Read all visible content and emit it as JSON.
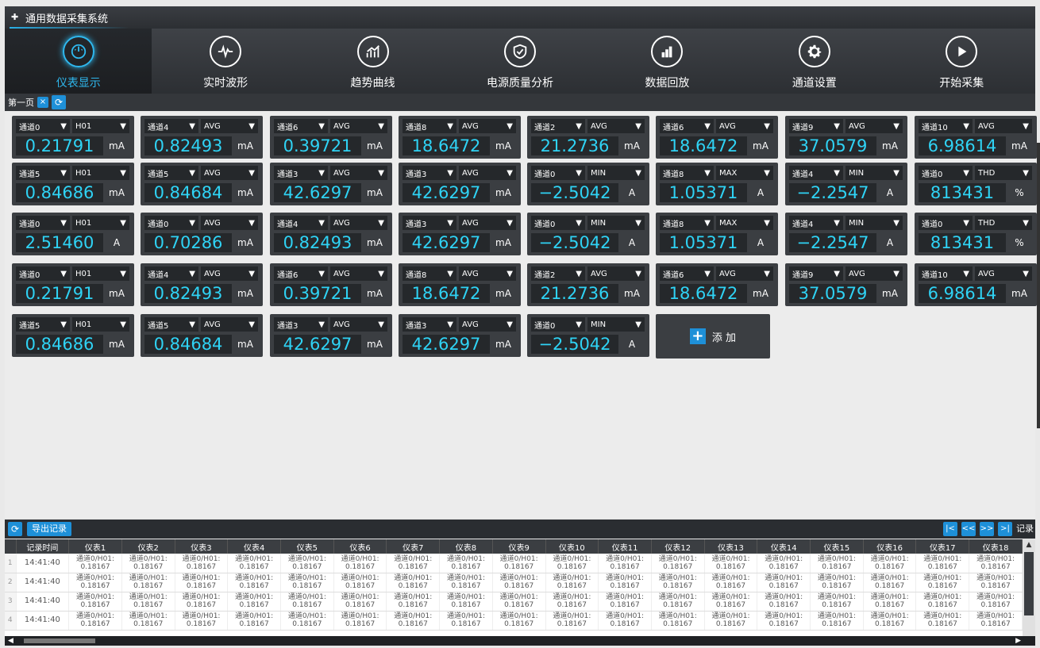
{
  "app": {
    "title": "通用数据采集系统"
  },
  "nav": [
    {
      "label": "仪表显示",
      "icon": "gauge-icon",
      "active": true
    },
    {
      "label": "实时波形",
      "icon": "pulse-icon"
    },
    {
      "label": "趋势曲线",
      "icon": "trend-chart-icon"
    },
    {
      "label": "电源质量分析",
      "icon": "shield-check-icon"
    },
    {
      "label": "数据回放",
      "icon": "bar-chart-icon"
    },
    {
      "label": "通道设置",
      "icon": "gear-icon"
    },
    {
      "label": "开始采集",
      "icon": "play-icon"
    }
  ],
  "page_tab": {
    "label": "第一页",
    "close": "×",
    "refresh": "⟳"
  },
  "meters": [
    {
      "ch": "通道0",
      "type": "H01",
      "value": "0.21791",
      "unit": "mA"
    },
    {
      "ch": "通道4",
      "type": "AVG",
      "value": "0.82493",
      "unit": "mA"
    },
    {
      "ch": "通道6",
      "type": "AVG",
      "value": "0.39721",
      "unit": "mA"
    },
    {
      "ch": "通道8",
      "type": "AVG",
      "value": "18.6472",
      "unit": "mA"
    },
    {
      "ch": "通道2",
      "type": "AVG",
      "value": "21.2736",
      "unit": "mA"
    },
    {
      "ch": "通道6",
      "type": "AVG",
      "value": "18.6472",
      "unit": "mA"
    },
    {
      "ch": "通道9",
      "type": "AVG",
      "value": "37.0579",
      "unit": "mA"
    },
    {
      "ch": "通道10",
      "type": "AVG",
      "value": "6.98614",
      "unit": "mA"
    },
    {
      "ch": "通道5",
      "type": "H01",
      "value": "0.84686",
      "unit": "mA"
    },
    {
      "ch": "通道5",
      "type": "AVG",
      "value": "0.84684",
      "unit": "mA"
    },
    {
      "ch": "通道3",
      "type": "AVG",
      "value": "42.6297",
      "unit": "mA"
    },
    {
      "ch": "通道3",
      "type": "AVG",
      "value": "42.6297",
      "unit": "mA"
    },
    {
      "ch": "通道0",
      "type": "MIN",
      "value": "−2.5042",
      "unit": "A"
    },
    {
      "ch": "通道8",
      "type": "MAX",
      "value": "1.05371",
      "unit": "A"
    },
    {
      "ch": "通道4",
      "type": "MIN",
      "value": "−2.2547",
      "unit": "A"
    },
    {
      "ch": "通道0",
      "type": "THD",
      "value": "813431",
      "unit": "%"
    },
    {
      "ch": "通道0",
      "type": "H01",
      "value": "2.51460",
      "unit": "A"
    },
    {
      "ch": "通道0",
      "type": "AVG",
      "value": "0.70286",
      "unit": "mA"
    },
    {
      "ch": "通道4",
      "type": "AVG",
      "value": "0.82493",
      "unit": "mA"
    },
    {
      "ch": "通道3",
      "type": "AVG",
      "value": "42.6297",
      "unit": "mA"
    },
    {
      "ch": "通道0",
      "type": "MIN",
      "value": "−2.5042",
      "unit": "A"
    },
    {
      "ch": "通道8",
      "type": "MAX",
      "value": "1.05371",
      "unit": "A"
    },
    {
      "ch": "通道4",
      "type": "MIN",
      "value": "−2.2547",
      "unit": "A"
    },
    {
      "ch": "通道0",
      "type": "THD",
      "value": "813431",
      "unit": "%"
    },
    {
      "ch": "通道0",
      "type": "H01",
      "value": "0.21791",
      "unit": "mA"
    },
    {
      "ch": "通道4",
      "type": "AVG",
      "value": "0.82493",
      "unit": "mA"
    },
    {
      "ch": "通道6",
      "type": "AVG",
      "value": "0.39721",
      "unit": "mA"
    },
    {
      "ch": "通道8",
      "type": "AVG",
      "value": "18.6472",
      "unit": "mA"
    },
    {
      "ch": "通道2",
      "type": "AVG",
      "value": "21.2736",
      "unit": "mA"
    },
    {
      "ch": "通道6",
      "type": "AVG",
      "value": "18.6472",
      "unit": "mA"
    },
    {
      "ch": "通道9",
      "type": "AVG",
      "value": "37.0579",
      "unit": "mA"
    },
    {
      "ch": "通道10",
      "type": "AVG",
      "value": "6.98614",
      "unit": "mA"
    },
    {
      "ch": "通道5",
      "type": "H01",
      "value": "0.84686",
      "unit": "mA"
    },
    {
      "ch": "通道5",
      "type": "AVG",
      "value": "0.84684",
      "unit": "mA"
    },
    {
      "ch": "通道3",
      "type": "AVG",
      "value": "42.6297",
      "unit": "mA"
    },
    {
      "ch": "通道3",
      "type": "AVG",
      "value": "42.6297",
      "unit": "mA"
    },
    {
      "ch": "通道0",
      "type": "MIN",
      "value": "−2.5042",
      "unit": "A"
    }
  ],
  "dropdown_arrow": "▼",
  "add_button": {
    "label": "添 加",
    "icon": "plus-icon"
  },
  "records_toolbar": {
    "refresh": "⟳",
    "export_label": "导出记录",
    "pager": {
      "first": "|<",
      "prev": "<<",
      "next": ">>",
      "last": ">|",
      "label": "记录"
    }
  },
  "table": {
    "headers": [
      "记录时间",
      "仪表1",
      "仪表2",
      "仪表3",
      "仪表4",
      "仪表5",
      "仪表6",
      "仪表7",
      "仪表8",
      "仪表9",
      "仪表10",
      "仪表11",
      "仪表12",
      "仪表13",
      "仪表14",
      "仪表15",
      "仪表16",
      "仪表17",
      "仪表18"
    ],
    "rows": [
      {
        "index": "1",
        "time": "14:41:40",
        "cell_line1": "通道0/H01:",
        "cell_line2": "0.18167"
      },
      {
        "index": "2",
        "time": "14:41:40",
        "cell_line1": "通道0/H01:",
        "cell_line2": "0.18167"
      },
      {
        "index": "3",
        "time": "14:41:40",
        "cell_line1": "通道0/H01:",
        "cell_line2": "0.18167"
      },
      {
        "index": "4",
        "time": "14:41:40",
        "cell_line1": "通道0/H01:",
        "cell_line2": "0.18167"
      }
    ]
  }
}
